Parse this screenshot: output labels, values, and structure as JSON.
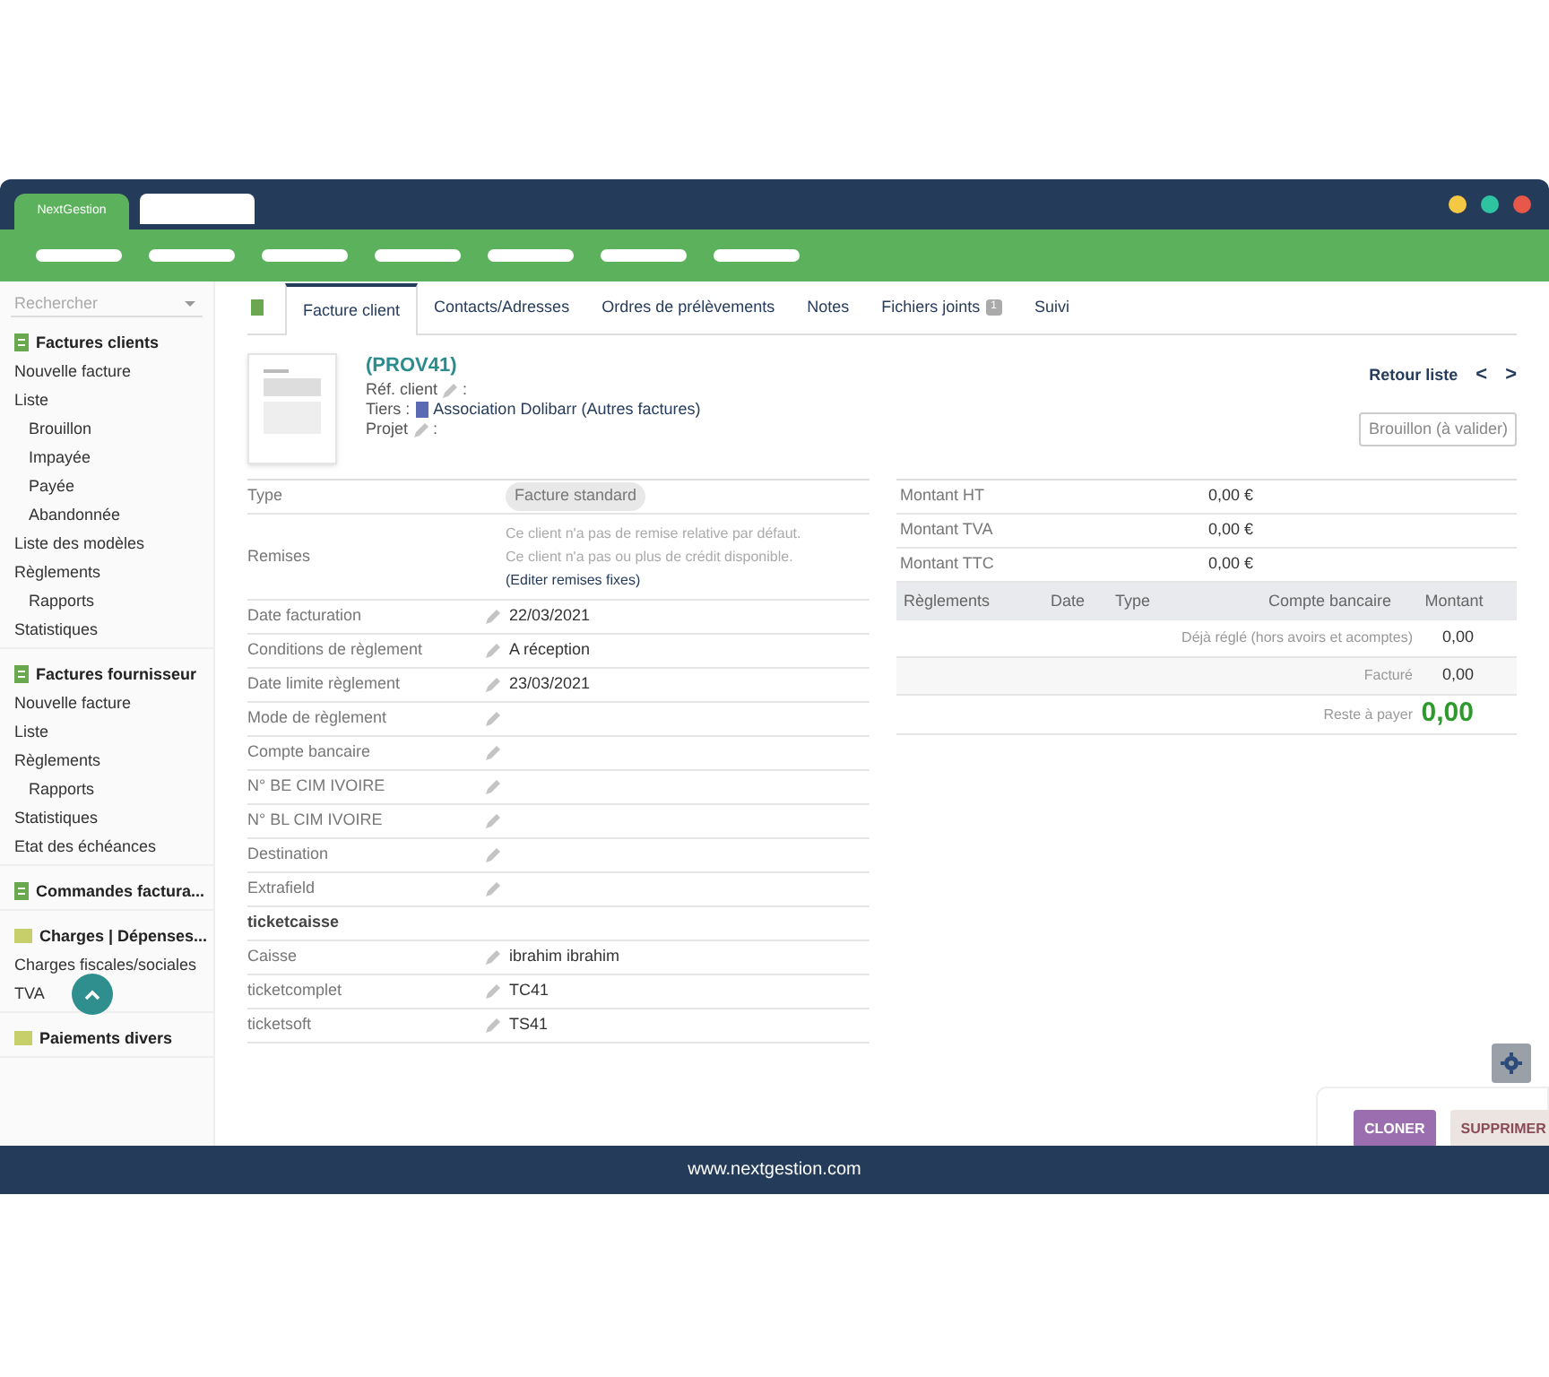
{
  "browser": {
    "tab_title": "NextGestion",
    "footer": "www.nextgestion.com"
  },
  "sidebar": {
    "search": {
      "placeholder": "Rechercher"
    },
    "sections": [
      {
        "title": "Factures clients",
        "kind": "invoice",
        "items": [
          {
            "label": "Nouvelle facture"
          },
          {
            "label": "Liste",
            "children": [
              {
                "label": "Brouillon"
              },
              {
                "label": "Impayée"
              },
              {
                "label": "Payée"
              },
              {
                "label": "Abandonnée"
              }
            ]
          },
          {
            "label": "Liste des modèles"
          },
          {
            "label": "Règlements",
            "children": [
              {
                "label": "Rapports"
              }
            ]
          },
          {
            "label": "Statistiques"
          }
        ]
      },
      {
        "title": "Factures fournisseur",
        "kind": "invoice",
        "items": [
          {
            "label": "Nouvelle facture"
          },
          {
            "label": "Liste"
          },
          {
            "label": "Règlements",
            "children": [
              {
                "label": "Rapports"
              }
            ]
          },
          {
            "label": "Statistiques"
          },
          {
            "label": "Etat des échéances"
          }
        ]
      },
      {
        "title": "Commandes factura...",
        "kind": "invoice"
      },
      {
        "title": "Charges | Dépenses...",
        "kind": "folder",
        "items": [
          {
            "label": "Charges fiscales/sociales"
          },
          {
            "label": "TVA"
          }
        ]
      },
      {
        "title": "Paiements divers",
        "kind": "folder"
      }
    ]
  },
  "tabs": [
    {
      "label": "Facture client",
      "selected": true
    },
    {
      "label": "Contacts/Adresses",
      "selected": false
    },
    {
      "label": "Ordres de prélèvements",
      "selected": false
    },
    {
      "label": "Notes",
      "selected": false
    },
    {
      "label": "Fichiers joints",
      "badge": "1",
      "selected": false
    },
    {
      "label": "Suivi",
      "selected": false
    }
  ],
  "header": {
    "ref": "(PROV41)",
    "ref_client_label": "Réf. client",
    "ref_client_separator": ":",
    "tiers_label": "Tiers :",
    "tiers_value": "Association Dolibarr (Autres factures)",
    "projet_label": "Projet",
    "projet_separator": ":",
    "back_link": "Retour liste",
    "prev": "<",
    "next": ">",
    "status": "Brouillon (à valider)"
  },
  "fields": [
    {
      "label": "Type",
      "kind": "badge",
      "value": "Facture standard"
    },
    {
      "label": "Remises",
      "kind": "remises",
      "lines": [
        "Ce client n'a pas de remise relative par défaut.",
        "Ce client n'a pas ou plus de crédit disponible."
      ],
      "link": "(Editer remises fixes)"
    },
    {
      "label": "Date facturation",
      "kind": "field",
      "editable": true,
      "value": "22/03/2021"
    },
    {
      "label": "Conditions de règlement",
      "kind": "field",
      "editable": true,
      "value": "A réception"
    },
    {
      "label": "Date limite règlement",
      "kind": "field",
      "editable": true,
      "value": "23/03/2021"
    },
    {
      "label": "Mode de règlement",
      "kind": "field",
      "editable": true
    },
    {
      "label": "Compte bancaire",
      "kind": "field",
      "editable": true
    },
    {
      "label": "N° BE CIM IVOIRE",
      "kind": "field",
      "editable": true
    },
    {
      "label": "N° BL CIM IVOIRE",
      "kind": "field",
      "editable": true
    },
    {
      "label": "Destination",
      "kind": "field",
      "editable": true
    },
    {
      "label": "Extrafield",
      "kind": "field",
      "editable": true
    },
    {
      "label": "ticketcaisse",
      "kind": "heading"
    },
    {
      "label": "Caisse",
      "kind": "field",
      "editable": true,
      "value": "ibrahim ibrahim"
    },
    {
      "label": "ticketcomplet",
      "kind": "field",
      "editable": true,
      "value": "TC41"
    },
    {
      "label": "ticketsoft",
      "kind": "field",
      "editable": true,
      "value": "TS41"
    }
  ],
  "amounts": [
    {
      "label": "Montant HT",
      "value": "0,00 €"
    },
    {
      "label": "Montant TVA",
      "value": "0,00 €"
    },
    {
      "label": "Montant TTC",
      "value": "0,00 €"
    }
  ],
  "payments": {
    "columns": [
      "Règlements",
      "Date",
      "Type",
      "Compte bancaire",
      "Montant"
    ],
    "summary": [
      {
        "label": "Déjà réglé (hors avoirs et acomptes)",
        "value": "0,00",
        "kind": "normal"
      },
      {
        "label": "Facturé",
        "value": "0,00",
        "kind": "normal"
      },
      {
        "label": "Reste à payer",
        "value": "0,00",
        "kind": "total"
      }
    ]
  },
  "actions": [
    "CLONER",
    "SUPPRIMER"
  ]
}
